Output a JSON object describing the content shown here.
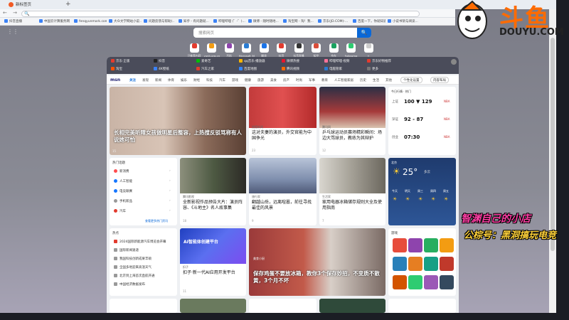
{
  "browser": {
    "tab_title": "新标签页",
    "new_tab": "+",
    "nav": "← → ↻",
    "address_glyph": "🔍",
    "favorites": [
      "抖音直播",
      "中国云计算服务网（博...",
      "fenqyunmark.com",
      "大众文学网站小说...",
      "问题反馈与帮助(..",
      "知乎 - 有问题就...",
      "哔哩哔哩 (゜-゜)...",
      "微博 - 随时随地...",
      "淘宝网 - 淘！我...",
      "京东(JD.COM)-...",
      "百度一下，你就知道",
      "小说书架与阅读..."
    ]
  },
  "newtab": {
    "apps_glyph": "⋮⋮",
    "search_placeholder": "搜索网页",
    "search_button": "🔍",
    "quicklinks": [
      {
        "label": "已推荐内容",
        "color": "#e23b2e"
      },
      {
        "label": "yunh.org.cn",
        "color": "#f39c12"
      },
      {
        "label": "百科",
        "color": "#8e44ad"
      },
      {
        "label": "Microsoft 365",
        "color": "#2b7cd3"
      },
      {
        "label": "翻译",
        "color": "#1a73e8"
      },
      {
        "label": "抖音",
        "color": "#e23b2e"
      },
      {
        "label": "抖音直播",
        "color": "#333333"
      },
      {
        "label": "知乎",
        "color": "#d94d3a"
      },
      {
        "label": "京东",
        "color": "#1aa260"
      },
      {
        "label": "Following",
        "color": "#2ecc71"
      },
      {
        "label": "+",
        "color": "#cccccc"
      }
    ],
    "site_rows": [
      {
        "label": "京东·正版",
        "color": "#e23b2e"
      },
      {
        "label": "抖音",
        "color": "#222222"
      },
      {
        "label": "爱奇艺",
        "color": "#00be06"
      },
      {
        "label": "qq音乐·播放器",
        "color": "#f7b500"
      },
      {
        "label": "微博热搜",
        "color": "#e6162d"
      },
      {
        "label": "哔哩哔哩·视频",
        "color": "#fb7299"
      },
      {
        "label": "京东好物推荐",
        "color": "#e23b2e"
      },
      {
        "label": "淘宝",
        "color": "#ff5000"
      },
      {
        "label": "4K壁纸",
        "color": "#3b82f6"
      },
      {
        "label": "汽车之家",
        "color": "#e23b2e"
      },
      {
        "label": "百度地图",
        "color": "#3385ff"
      },
      {
        "label": "腾讯视频",
        "color": "#ff6a00"
      },
      {
        "label": "电脑管家",
        "color": "#2b7cd3"
      },
      {
        "label": "更多",
        "color": "#777777"
      }
    ]
  },
  "feed": {
    "logo": "msn",
    "tabs": [
      "关注",
      "发现",
      "新闻",
      "体育",
      "娱乐",
      "财经",
      "科技",
      "汽车",
      "游戏",
      "健康",
      "旅游",
      "美食",
      "房产",
      "时尚",
      "军事",
      "教育",
      "人工智能",
      "家居",
      "历史",
      "生活",
      "其他"
    ],
    "pill_personalize": "个性化设置",
    "pill_layout": "内容布局",
    "hero": {
      "title": "长相完美听障女孩做明星后整容，上热搜反驳骂称有人说她可怕",
      "source": "网易新闻",
      "likes": "15"
    },
    "card_a": {
      "title": "这对夫妻的演员，外交官能为中国争光",
      "source": "搜狐新闻",
      "likes": "23"
    },
    "card_b": {
      "title": "乒乓球运动员赛场精彩瞬间：场边大骂球员，教练为其辩护",
      "source": "腾讯网",
      "likes": "12"
    },
    "stocks": {
      "title": "今日行情 · 热门",
      "rows": [
        {
          "name": "上证",
          "value": "100 ▼ 129",
          "flag": "NBA"
        },
        {
          "name": "深证",
          "value": "92 - 87",
          "flag": "NBA"
        },
        {
          "name": "创业",
          "value": "07:30",
          "flag": "NBA"
        }
      ]
    },
    "hot_list": {
      "title": "热门话题",
      "items": [
        "新消费",
        "人工智能",
        "电竞联赛",
        "手机新品",
        "汽车"
      ],
      "colors": [
        "#ff4d4f",
        "#1677ff",
        "#1677ff",
        "#999999",
        "#e23b2e"
      ],
      "more": "查看更多热门资讯"
    },
    "card_c": {
      "title": "全新影视作品预告大片：演员阵容、《斗地主》名人故事集",
      "source": "腾讯影视",
      "likes": "18"
    },
    "card_d": {
      "title": "翻越山岳，远离喧嚣，前往寻找最佳的风景",
      "source": "旅行家",
      "likes": "9"
    },
    "card_e": {
      "title": "家用电器冰箱储存规则大全及使用指南",
      "source": "生活家",
      "likes": "7"
    },
    "weather": {
      "city": "北京",
      "temp": "25°",
      "desc": "多云",
      "days": [
        "今天",
        "明天",
        "周三",
        "周四",
        "周五"
      ]
    },
    "news_list": {
      "title": "热点",
      "items": [
        "2024国际新能源汽车博览会开幕",
        "国际新闻速递",
        "我国科技创新成果丰硕",
        "全国多地迎来高温天气",
        "北京到上海首次直航开通",
        "中国经济数据发布"
      ]
    },
    "ai_card": {
      "title": "扣子·新一代AI应用开发平台",
      "banner": "AI智能体创建平台",
      "source": "扣子",
      "likes": "11"
    },
    "fridge": {
      "title": "保存鸡蛋不要放冰箱，教你3个保存妙招，不变质不散黄，3个月不坏",
      "source": "美食小厨"
    },
    "games": {
      "title": "游戏",
      "tiles": [
        "#e74c3c",
        "#8e44ad",
        "#27ae60",
        "#f39c12",
        "#2980b9",
        "#e67e22",
        "#16a085",
        "#c0392b",
        "#d35400",
        "#2ecc71",
        "#9b59b6",
        "#34495e"
      ]
    }
  },
  "watermark": {
    "brand_cn": "斗鱼",
    "brand_en": "DOUYU.COM",
    "line1": "智渊自己的小店",
    "line2": "公棕号：黑洞搞玩电竞"
  }
}
